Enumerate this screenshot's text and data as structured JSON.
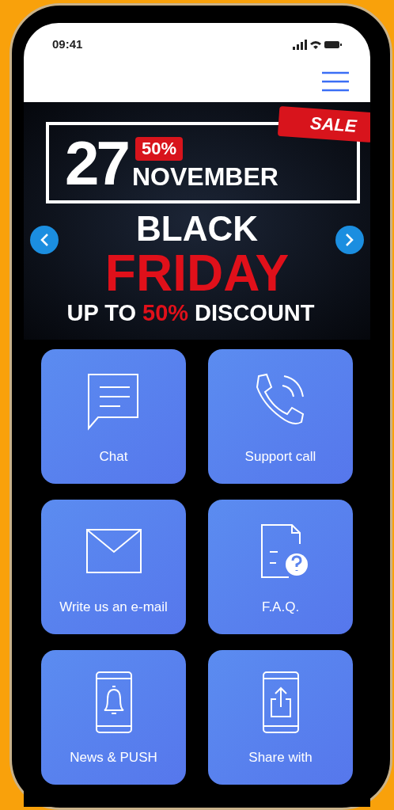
{
  "status_bar": {
    "time": "09:41"
  },
  "banner": {
    "date_number": "27",
    "discount_tag": "50%",
    "date_month": "NOVEMBER",
    "sale_tag": "SALE",
    "headline_top": "BLACK",
    "headline_main": "FRIDAY",
    "offer_prefix": "UP TO",
    "offer_value": "50%",
    "offer_suffix": "DISCOUNT"
  },
  "tiles": [
    {
      "kind": "chat",
      "label": "Chat"
    },
    {
      "kind": "call",
      "label": "Support call"
    },
    {
      "kind": "email",
      "label": "Write us an e-mail"
    },
    {
      "kind": "faq",
      "label": "F.A.Q."
    },
    {
      "kind": "push",
      "label": "News & PUSH"
    },
    {
      "kind": "share",
      "label": "Share with"
    }
  ]
}
